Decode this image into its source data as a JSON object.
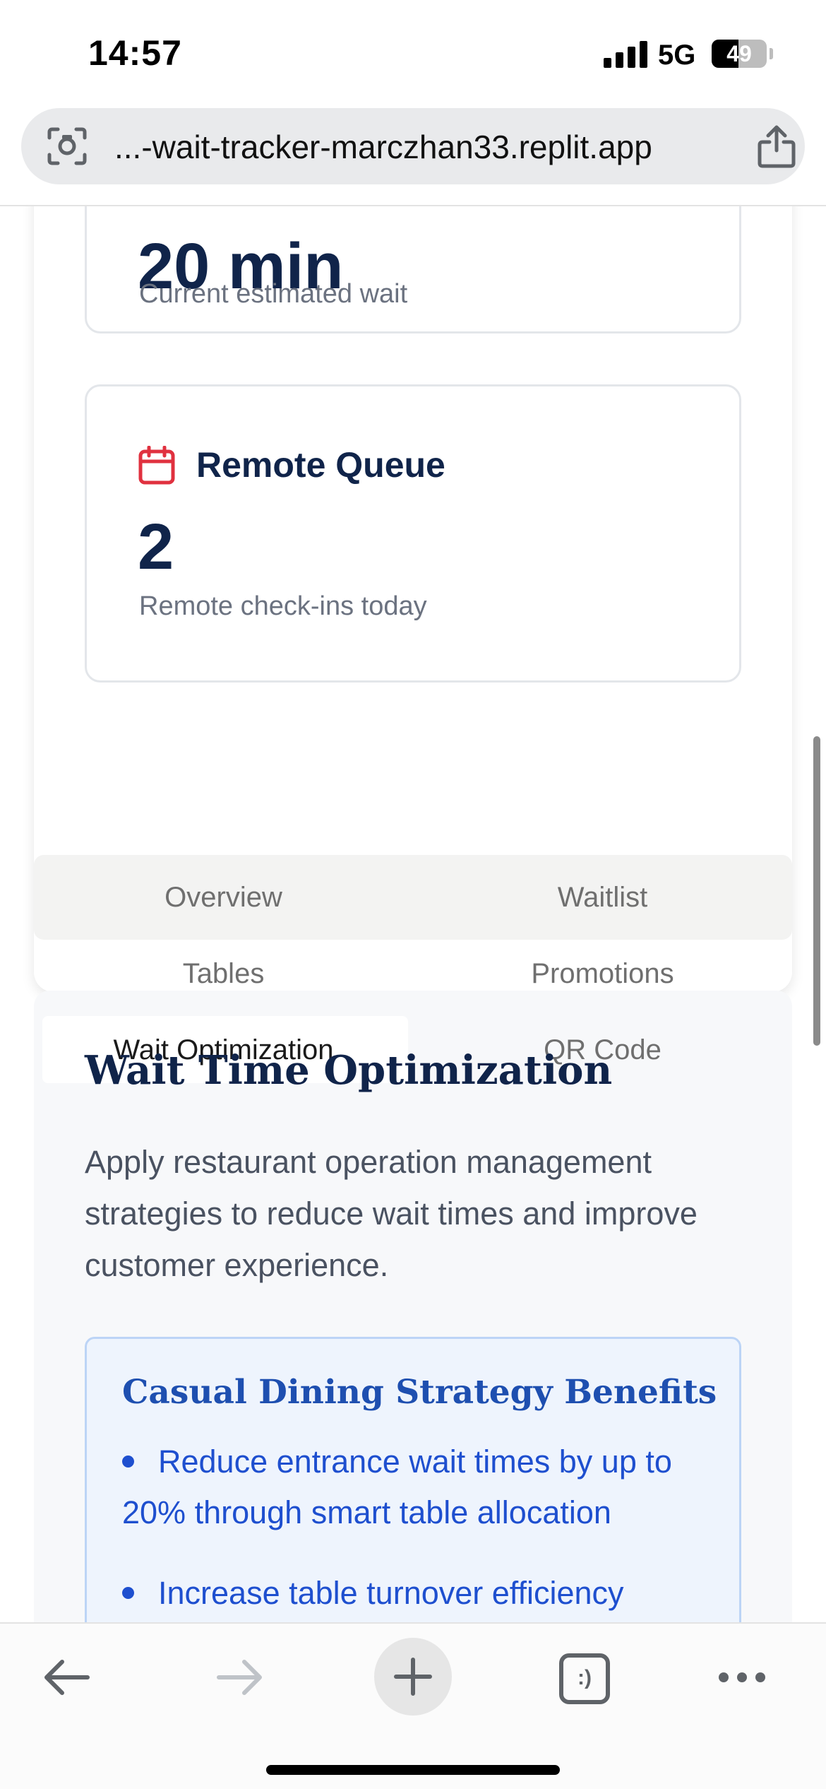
{
  "status_bar": {
    "time": "14:57",
    "network": "5G",
    "battery_percent": "49",
    "battery_level": 0.49,
    "signal_bars": 4
  },
  "browser": {
    "url": "...-wait-tracker-marczhan33.replit.app",
    "lens_icon": "camera-search-icon",
    "share_icon": "share-icon"
  },
  "stats": {
    "wait": {
      "value": "20 min",
      "subtitle": "Current estimated wait"
    },
    "remote": {
      "title": "Remote Queue",
      "icon": "calendar-icon",
      "value": "2",
      "subtitle": "Remote check-ins today"
    }
  },
  "tabs": [
    {
      "label": "Overview",
      "active": false
    },
    {
      "label": "Waitlist",
      "active": false
    },
    {
      "label": "Tables",
      "active": false
    },
    {
      "label": "Promotions",
      "active": false
    },
    {
      "label": "Wait Optimization",
      "active": true
    },
    {
      "label": "QR Code",
      "active": false
    }
  ],
  "optimization": {
    "title": "Wait Time Optimization",
    "description": "Apply restaurant operation management strategies to reduce wait times and improve customer experience.",
    "benefits_title": "Casual Dining Strategy Benefits",
    "benefits": [
      "Reduce entrance wait times by up to 20% through smart table allocation",
      "Increase table turnover efficiency"
    ]
  },
  "toolbar": {
    "back_icon": "back-arrow-icon",
    "forward_icon": "forward-arrow-icon",
    "new_tab_icon": "plus-icon",
    "tabs_icon": "tabs-icon",
    "tabs_glyph": ":)",
    "more_icon": "more-icon"
  },
  "colors": {
    "accent_red": "#e0313f",
    "navy": "#10244a",
    "benefit_blue": "#1e4fcf"
  }
}
